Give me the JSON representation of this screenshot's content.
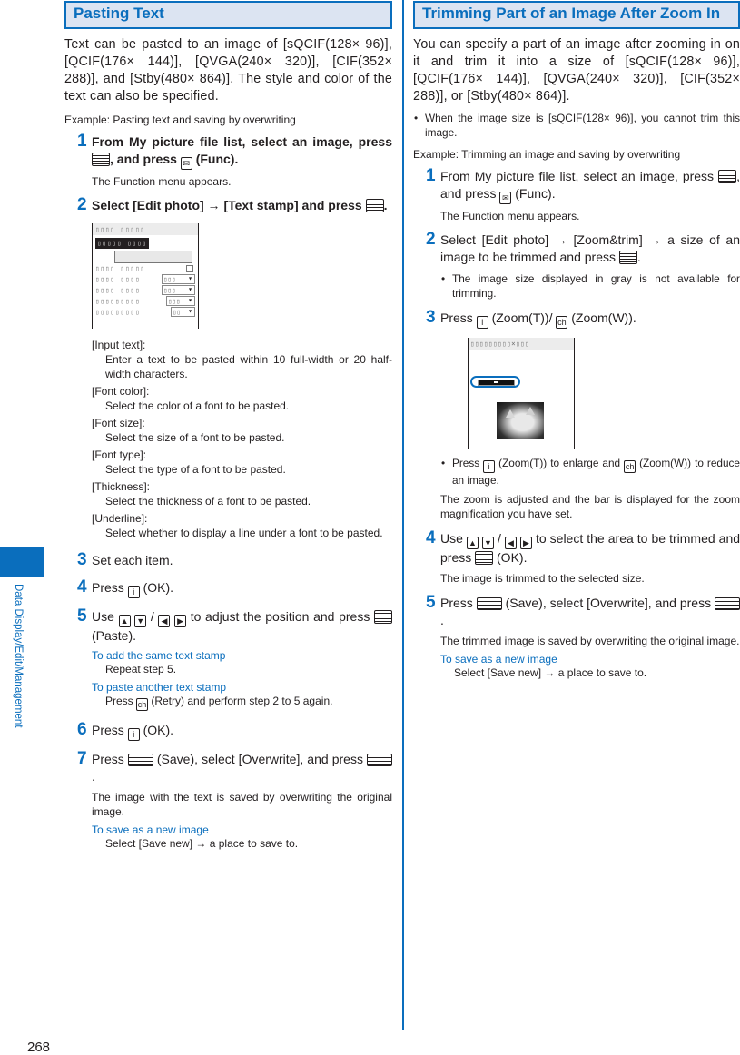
{
  "side_tab": {
    "label": "Data Display/Edit/Management"
  },
  "page_number": "268",
  "left": {
    "title": "Pasting Text",
    "intro": "Text can be pasted to an image of [sQCIF(128× 96)], [QCIF(176× 144)], [QVGA(240× 320)], [CIF(352× 288)], and [Stby(480× 864)]. The style and color of the text can also be specified.",
    "example": "Example: Pasting text and saving by overwriting",
    "steps": [
      {
        "num": "1",
        "text_a": "From My picture file list, select an image, press ",
        "text_b": ", and press ",
        "text_c": " (Func).",
        "note": "The Function menu appears."
      },
      {
        "num": "2",
        "text_a": "Select [Edit photo] → [Text stamp] and press ",
        "text_b": "."
      },
      {
        "num": "3",
        "text": "Set each item."
      },
      {
        "num": "4",
        "text_a": "Press ",
        "text_b": " (OK)."
      },
      {
        "num": "5",
        "text_a": "Use ",
        "sep": "/",
        "text_b": " to adjust the position and press ",
        "text_c": " (Paste).",
        "links": [
          {
            "label": "To add the same text stamp",
            "detail": "Repeat step 5."
          },
          {
            "label": "To paste another text stamp",
            "detail_a": "Press ",
            "detail_b": " (Retry) and perform step 2 to 5 again."
          }
        ]
      },
      {
        "num": "6",
        "text_a": "Press ",
        "text_b": " (OK)."
      },
      {
        "num": "7",
        "text_a": "Press ",
        "text_b": " (Save), select [Overwrite], and press ",
        "text_c": ".",
        "note": "The image with the text is saved by overwriting the original image.",
        "link": "To save as a new image",
        "link_detail": "Select [Save new] → a place to save to."
      }
    ],
    "definitions": [
      {
        "label": "[Input text]:",
        "text": "Enter a text to be pasted within 10 full-width or 20 half-width characters."
      },
      {
        "label": "[Font color]:",
        "text": "Select the color of a font to be pasted."
      },
      {
        "label": "[Font size]:",
        "text": "Select the size of a font to be pasted."
      },
      {
        "label": "[Font type]:",
        "text": "Select the type of a font to be pasted."
      },
      {
        "label": "[Thickness]:",
        "text": "Select the thickness of a font to be pasted."
      },
      {
        "label": "[Underline]:",
        "text": "Select whether to display a line under a font to be pasted."
      }
    ],
    "screen": {
      "title": "▯▯▯▯ ▯▯▯▯▯",
      "highlight": "▯▯▯▯▯ ▯▯▯▯",
      "rows": [
        "▯▯▯▯ ▯▯▯▯▯",
        "▯▯▯▯ ▯▯▯▯",
        "▯▯▯▯ ▯▯▯▯",
        "▯▯▯▯▯▯▯▯▯",
        "▯▯▯▯▯▯▯▯▯"
      ],
      "selects": [
        "▯▯▯",
        "▯▯▯",
        "▯▯▯",
        "▯▯"
      ]
    }
  },
  "right": {
    "title": "Trimming Part of an Image After Zoom In",
    "intro": "You can specify a part of an image after zooming in on it and trim it into a size of [sQCIF(128× 96)], [QCIF(176× 144)], [QVGA(240× 320)], [CIF(352× 288)], or [Stby(480× 864)].",
    "bullet": "When the image size is [sQCIF(128× 96)], you cannot trim this image.",
    "example": "Example: Trimming an image and saving by overwriting",
    "steps": [
      {
        "num": "1",
        "text_a": "From My picture file list, select an image, press ",
        "text_b": ", and press ",
        "text_c": " (Func).",
        "note": "The Function menu appears."
      },
      {
        "num": "2",
        "text_a": "Select [Edit photo] → [Zoom&trim] → a size of an image to be trimmed and press ",
        "text_b": ".",
        "bullet": "The image size displayed in gray is not available for trimming."
      },
      {
        "num": "3",
        "text_a": "Press ",
        "text_b": " (Zoom(T))/ ",
        "text_c": " (Zoom(W)).",
        "bullet_a": "Press ",
        "bullet_b": " (Zoom(T)) to enlarge and ",
        "bullet_c": " (Zoom(W)) to reduce an image.",
        "note": "The zoom is adjusted and the bar is displayed for the zoom magnification you have set."
      },
      {
        "num": "4",
        "text_a": "Use ",
        "sep": "/",
        "text_b": " to select the area to be trimmed and press ",
        "text_c": " (OK).",
        "note": "The image is trimmed to the selected size."
      },
      {
        "num": "5",
        "text_a": "Press ",
        "text_b": " (Save), select [Overwrite], and press ",
        "text_c": ".",
        "note": "The trimmed image is saved by overwriting the original image.",
        "link": "To save as a new image",
        "link_detail": "Select [Save new] → a place to save to."
      }
    ],
    "screen": {
      "title": "▯▯▯▯▯▯▯▯▯×▯▯▯"
    }
  },
  "keys": {
    "up": "▲",
    "down": "▼",
    "left": "◀",
    "right": "▶",
    "mail": "✉",
    "i": "i",
    "ch": "ch"
  }
}
